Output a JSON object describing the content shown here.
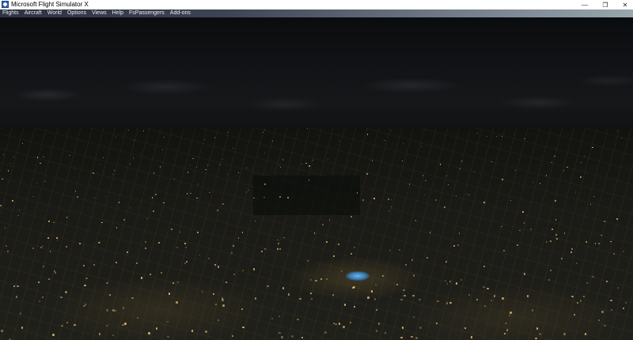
{
  "window": {
    "title": "Microsoft Flight Simulator X",
    "controls": {
      "minimize": "—",
      "maximize": "❐",
      "close": "✕"
    }
  },
  "menu": {
    "items": [
      "Flights",
      "Aircraft",
      "World",
      "Options",
      "Views",
      "Help",
      "FsPassengers",
      "Add-ons"
    ]
  },
  "colors": {
    "sky": "#111316",
    "ground": "#1a1a16",
    "city_lights": "#ffd27a",
    "stadium": "#6fb5e8"
  }
}
